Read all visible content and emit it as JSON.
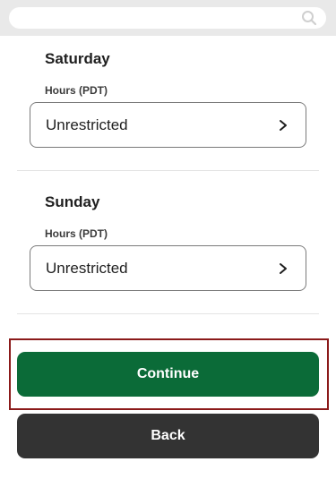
{
  "search": {
    "icon": "search-icon"
  },
  "days": [
    {
      "name": "Saturday",
      "hours_label": "Hours (PDT)",
      "value": "Unrestricted",
      "icon": "chevron-right-icon"
    },
    {
      "name": "Sunday",
      "hours_label": "Hours (PDT)",
      "value": "Unrestricted",
      "icon": "chevron-right-icon"
    }
  ],
  "actions": {
    "continue_label": "Continue",
    "back_label": "Back"
  },
  "colors": {
    "continue": "#0b6b38",
    "back": "#333333",
    "highlight_border": "#8b1a1a"
  }
}
